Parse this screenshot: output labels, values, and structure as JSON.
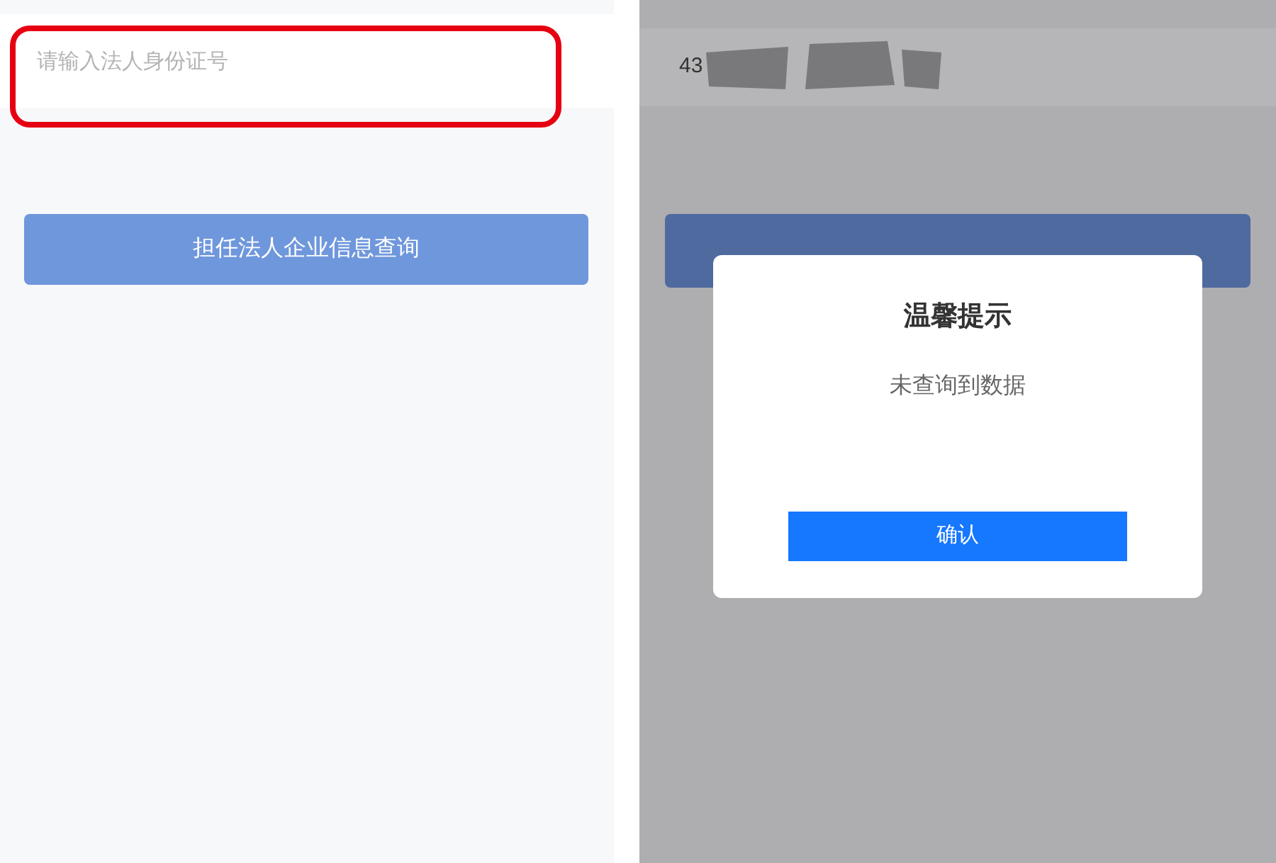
{
  "left_screen": {
    "id_field": {
      "placeholder": "请输入法人身份证号",
      "highlighted": true
    },
    "query_button": "担任法人企业信息查询"
  },
  "right_screen": {
    "id_field": {
      "value": "43"
    },
    "dialog": {
      "title": "温馨提示",
      "message": "未查询到数据",
      "confirm_button": "确认"
    }
  }
}
